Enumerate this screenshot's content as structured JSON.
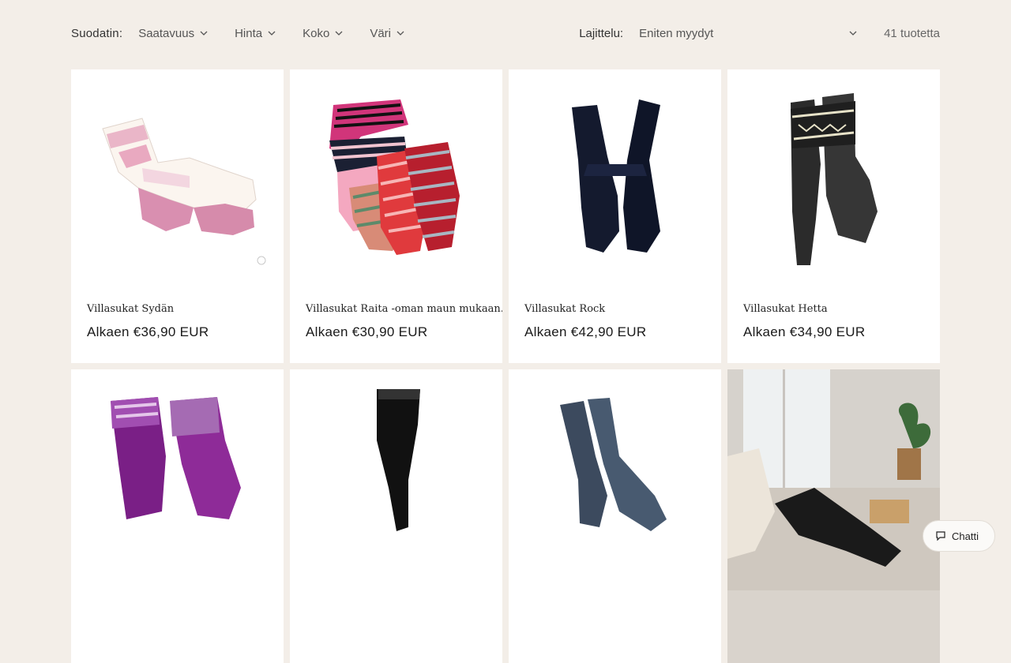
{
  "filters": {
    "label": "Suodatin:",
    "items": [
      {
        "label": "Saatavuus"
      },
      {
        "label": "Hinta"
      },
      {
        "label": "Koko"
      },
      {
        "label": "Väri"
      }
    ]
  },
  "sort": {
    "label": "Lajittelu:",
    "selected": "Eniten myydyt"
  },
  "product_count": "41 tuotetta",
  "products": [
    {
      "title": "Villasukat Sydän",
      "price": "Alkaen €36,90 EUR"
    },
    {
      "title": "Villasukat Raita -oman maun mukaan.",
      "price": "Alkaen €30,90 EUR"
    },
    {
      "title": "Villasukat Rock",
      "price": "Alkaen €42,90 EUR"
    },
    {
      "title": "Villasukat Hetta",
      "price": "Alkaen €34,90 EUR"
    }
  ],
  "chat": {
    "label": "Chatti",
    "icon": "chat-bubble-icon"
  },
  "colors": {
    "background": "#f3eee8",
    "card": "#ffffff"
  }
}
